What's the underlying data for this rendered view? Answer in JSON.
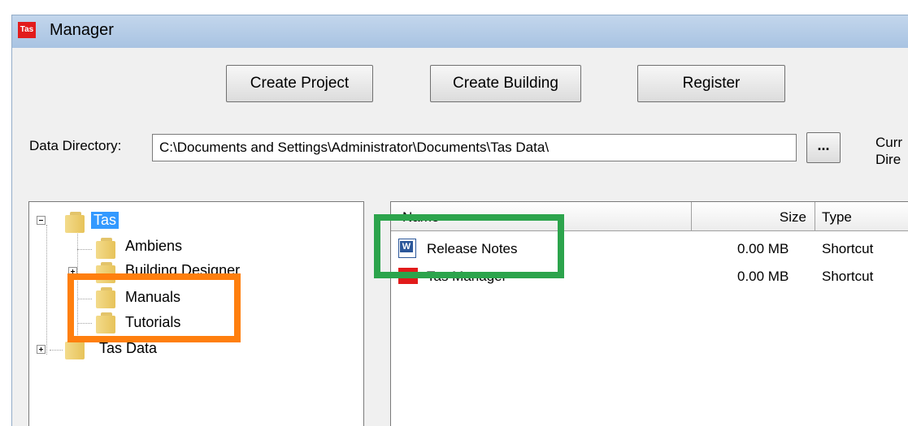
{
  "window": {
    "icon_label": "Tas",
    "title": "Manager"
  },
  "buttons": {
    "create_project": "Create Project",
    "create_building": "Create Building",
    "register": "Register"
  },
  "data_directory": {
    "label": "Data Directory:",
    "value": "C:\\Documents and Settings\\Administrator\\Documents\\Tas Data\\",
    "browse_label": "..."
  },
  "current_directory_label": {
    "line1": "Curr",
    "line2": "Dire"
  },
  "tree": {
    "root": "Tas",
    "children": [
      "Ambiens",
      "Building Designer",
      "Manuals",
      "Tutorials"
    ],
    "sibling": "Tas Data"
  },
  "list": {
    "columns": {
      "name": "Name",
      "size": "Size",
      "type": "Type"
    },
    "rows": [
      {
        "name": "Release Notes",
        "size": "0.00 MB",
        "type": "Shortcut",
        "icon": "word-document-icon"
      },
      {
        "name": "Tas Manager",
        "size": "0.00 MB",
        "type": "Shortcut",
        "icon": "tas-app-icon",
        "icon_label": "Tas"
      }
    ]
  },
  "colors": {
    "highlight_orange": "#ff7f0e",
    "highlight_green": "#2ca44c",
    "selection": "#3399ff",
    "tas_red": "#e21b1b"
  }
}
